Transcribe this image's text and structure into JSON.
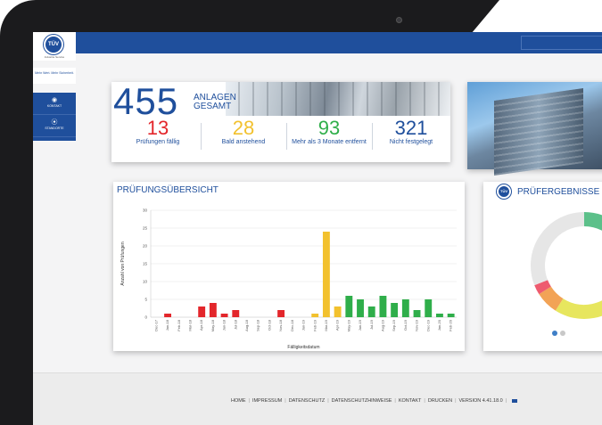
{
  "header": {
    "search_placeholder": ""
  },
  "sidebar": {
    "logo": "TÜV",
    "brand": "Industrie Service",
    "tagline": "Mehr Wert. Mehr Sicherheit.",
    "nav": [
      {
        "label": "KONTAKT",
        "icon": "eye-icon"
      },
      {
        "label": "STANDORTE",
        "icon": "pin-icon"
      }
    ]
  },
  "summary": {
    "total": "455",
    "total_label_line1": "ANLAGEN",
    "total_label_line2": "GESAMT",
    "stats": [
      {
        "value": "13",
        "label": "Prüfungen fällig",
        "color": "#e3262b"
      },
      {
        "value": "28",
        "label": "Bald anstehend",
        "color": "#f2c12e"
      },
      {
        "value": "93",
        "label": "Mehr als 3 Monate entfernt",
        "color": "#2fae4a"
      },
      {
        "value": "321",
        "label": "Nicht festgelegt",
        "color": "#1f4f9c"
      }
    ]
  },
  "overview": {
    "title": "PRÜFUNGSÜBERSICHT"
  },
  "chart_data": {
    "type": "bar",
    "title": "PRÜFUNGSÜBERSICHT",
    "xlabel": "Fälligkeitsdatum",
    "ylabel": "Anzahl von Prüfungen",
    "ylim": [
      0,
      30
    ],
    "yticks": [
      0,
      5,
      10,
      15,
      20,
      25,
      30
    ],
    "grid": true,
    "categories": [
      "Dec-17",
      "Jan-18",
      "Feb-18",
      "Mar-18",
      "Apr-18",
      "May-18",
      "Jun-18",
      "Jul-18",
      "Aug-18",
      "Sep-18",
      "Oct-18",
      "Nov-18",
      "Dec-18",
      "Jan-19",
      "Feb-19",
      "Mar-19",
      "Apr-19",
      "May-19",
      "Jun-19",
      "Jul-19",
      "Aug-19",
      "Sep-19",
      "Oct-19",
      "Nov-19",
      "Dec-19",
      "Jan-20",
      "Feb-20"
    ],
    "values": [
      0,
      1,
      0,
      0,
      3,
      4,
      1,
      2,
      0,
      0,
      0,
      2,
      0,
      0,
      1,
      24,
      3,
      6,
      5,
      3,
      6,
      4,
      5,
      2,
      5,
      1,
      1
    ],
    "colors": [
      "#e3262b",
      "#e3262b",
      "#e3262b",
      "#e3262b",
      "#e3262b",
      "#e3262b",
      "#e3262b",
      "#e3262b",
      "#e3262b",
      "#e3262b",
      "#e3262b",
      "#e3262b",
      "#e3262b",
      "#e3262b",
      "#f2c12e",
      "#f2c12e",
      "#f2c12e",
      "#2fae4a",
      "#2fae4a",
      "#2fae4a",
      "#2fae4a",
      "#2fae4a",
      "#2fae4a",
      "#2fae4a",
      "#2fae4a",
      "#2fae4a",
      "#2fae4a"
    ]
  },
  "results": {
    "title": "PRÜFERGEBNISSE",
    "donut": [
      {
        "value": 35,
        "color": "#5cc08a"
      },
      {
        "value": 24,
        "color": "#e7e65e"
      },
      {
        "value": 7,
        "color": "#f2a356"
      },
      {
        "value": 3,
        "color": "#ee5b6f"
      },
      {
        "value": 31,
        "color": "#e6e6e6"
      }
    ],
    "pager": [
      {
        "active": true
      },
      {
        "active": false
      }
    ]
  },
  "footer": {
    "links": [
      "HOME",
      "IMPRESSUM",
      "DATENSCHUTZ",
      "DATENSCHUTZHINWEISE",
      "KONTAKT",
      "DRUCKEN",
      "VERSION 4.41.18.0"
    ]
  }
}
